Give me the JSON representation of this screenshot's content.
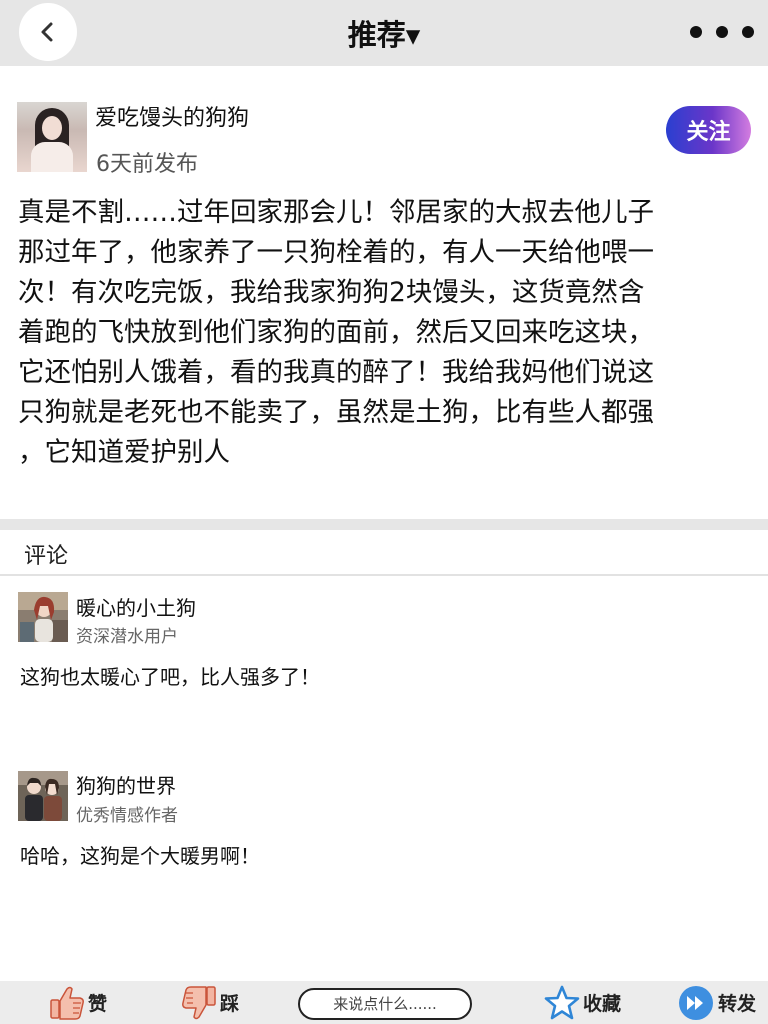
{
  "header": {
    "title": "推荐▾"
  },
  "post": {
    "author": "爱吃馒头的狗狗",
    "time": "6天前发布",
    "follow_label": "关注",
    "lines": [
      "真是不割……过年回家那会儿！邻居家的大叔去他儿子",
      "那过年了，他家养了一只狗栓着的，有人一天给他喂一",
      "次！有次吃完饭，我给我家狗狗2块馒头，这货竟然含",
      "着跑的飞快放到他们家狗的面前，然后又回来吃这块，",
      "它还怕别人饿着，看的我真的醉了！我给我妈他们说这",
      "只狗就是老死也不能卖了，虽然是土狗，比有些人都强",
      "，它知道爱护别人"
    ]
  },
  "comments_section": {
    "heading": "评论",
    "items": [
      {
        "name": "暖心的小土狗",
        "role": "资深潜水用户",
        "text": "这狗也太暖心了吧，比人强多了！"
      },
      {
        "name": "狗狗的世界",
        "role": "优秀情感作者",
        "text": "哈哈，这狗是个大暖男啊！"
      }
    ]
  },
  "bottom_bar": {
    "like_label": "赞",
    "dislike_label": "踩",
    "comment_placeholder": "来说点什么......",
    "favorite_label": "收藏",
    "share_label": "转发"
  },
  "colors": {
    "follow_gradient_start": "#2a3fd0",
    "follow_gradient_end": "#d37de0",
    "thumb_icon": "#e77a5f",
    "star_icon": "#2f86d6",
    "share_icon": "#3e8fe0",
    "bar_background": "#e6e6e6"
  },
  "icons": {
    "back": "chevron-left-icon",
    "more": "more-dots-icon",
    "like": "thumbs-up-icon",
    "dislike": "thumbs-down-icon",
    "favorite": "star-icon",
    "share": "share-play-icon"
  }
}
